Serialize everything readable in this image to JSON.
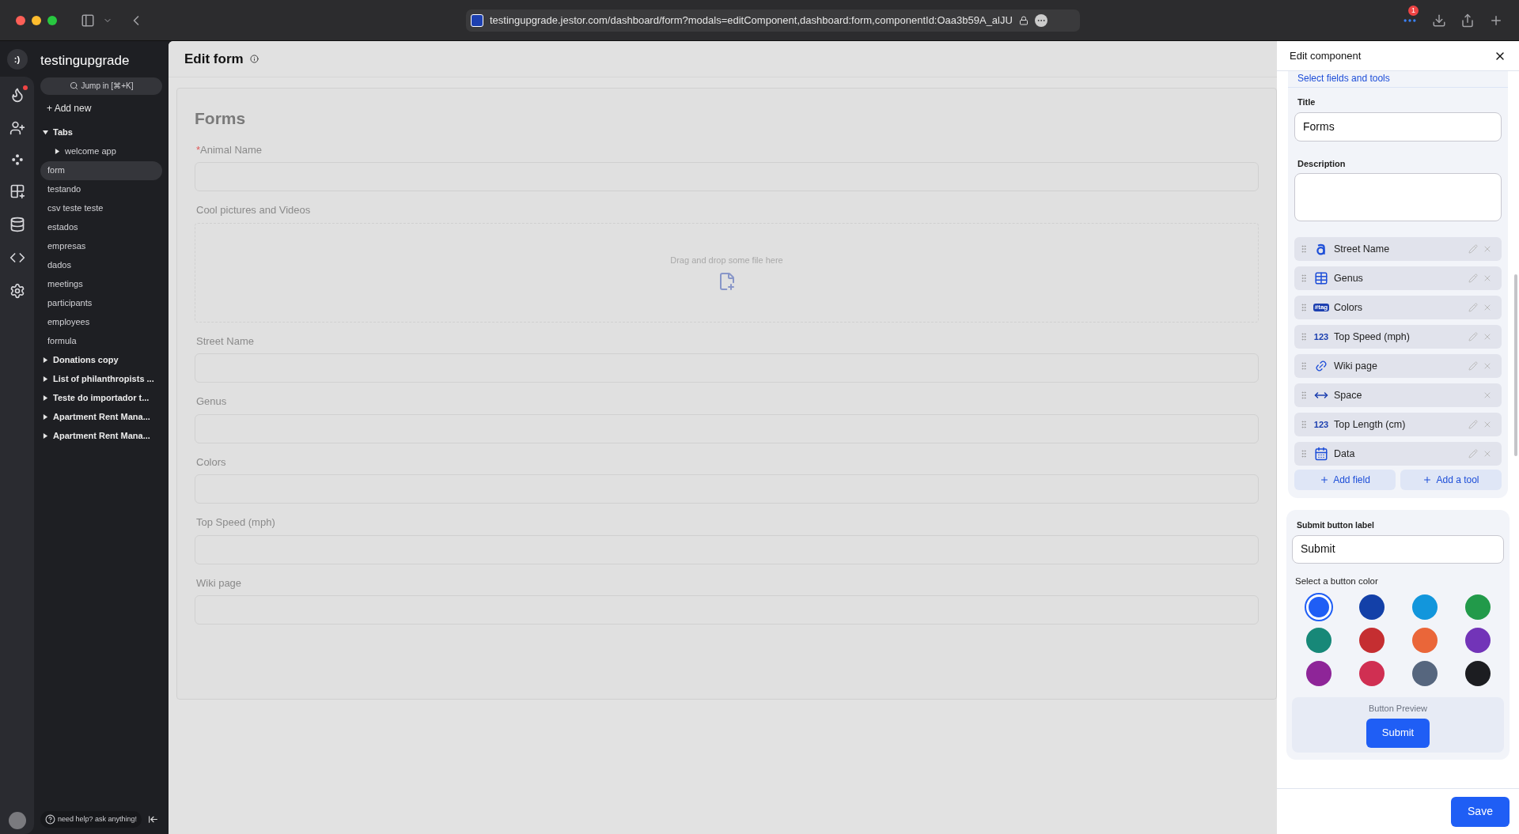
{
  "browser": {
    "url": "testingupgrade.jestor.com/dashboard/form?modals=editComponent,dashboard:form,componentId:Oaa3b59A_alJU",
    "notifications": "1"
  },
  "rail": [
    {
      "kind": "flame",
      "dot": true
    },
    {
      "kind": "user-plus",
      "dot": false
    },
    {
      "kind": "nodes",
      "dot": false
    },
    {
      "kind": "grid-plus",
      "dot": false
    },
    {
      "kind": "database",
      "dot": false
    },
    {
      "kind": "code",
      "dot": false
    },
    {
      "kind": "gear",
      "dot": false
    }
  ],
  "sidebar": {
    "logo": ":)",
    "workspace": "testingupgrade",
    "search": "Jump in [⌘+K]",
    "add_new": "+ Add new",
    "help": "need help? ask anything!",
    "items": [
      {
        "label": "Tabs",
        "kind": "folder",
        "expanded": true,
        "selected": false,
        "children": [
          {
            "label": "welcome app",
            "kind": "folder",
            "expanded": false,
            "selected": false
          },
          {
            "label": "form",
            "kind": "page",
            "selected": true
          },
          {
            "label": "testando",
            "kind": "page",
            "selected": false
          },
          {
            "label": "csv teste teste",
            "kind": "page",
            "selected": false
          },
          {
            "label": "estados",
            "kind": "page",
            "selected": false
          },
          {
            "label": "empresas",
            "kind": "page",
            "selected": false
          },
          {
            "label": "dados",
            "kind": "page",
            "selected": false
          },
          {
            "label": "meetings",
            "kind": "page",
            "selected": false
          },
          {
            "label": "participants",
            "kind": "page",
            "selected": false
          },
          {
            "label": "employees",
            "kind": "page",
            "selected": false
          },
          {
            "label": "formula",
            "kind": "page",
            "selected": false
          }
        ]
      },
      {
        "label": "Donations copy",
        "kind": "folder",
        "expanded": false,
        "selected": false
      },
      {
        "label": "List of philanthropists ...",
        "kind": "folder",
        "expanded": false,
        "selected": false
      },
      {
        "label": "Teste do importador t...",
        "kind": "folder",
        "expanded": false,
        "selected": false
      },
      {
        "label": "Apartment Rent Mana...",
        "kind": "folder",
        "expanded": false,
        "selected": false
      },
      {
        "label": "Apartment Rent Mana...",
        "kind": "folder",
        "expanded": false,
        "selected": false
      }
    ]
  },
  "page": {
    "title": "Edit form",
    "form_title": "Forms",
    "required_mark": "*",
    "fields": [
      {
        "label": "Animal Name",
        "kind": "input",
        "required": true
      },
      {
        "label": "Cool pictures and Videos",
        "kind": "file",
        "required": false,
        "placeholder": "Drag and drop some file here"
      },
      {
        "label": "Street Name",
        "kind": "input",
        "required": false
      },
      {
        "label": "Genus",
        "kind": "input",
        "required": false
      },
      {
        "label": "Colors",
        "kind": "input",
        "required": false
      },
      {
        "label": "Top Speed (mph)",
        "kind": "input",
        "required": false
      },
      {
        "label": "Wiki page",
        "kind": "input",
        "required": false
      }
    ]
  },
  "panel": {
    "title": "Edit component",
    "section_link": "Select fields and tools",
    "title_label": "Title",
    "title_value": "Forms",
    "description_label": "Description",
    "components": [
      {
        "label": "Street Name",
        "kind": "text",
        "editable": true
      },
      {
        "label": "Genus",
        "kind": "table",
        "editable": true
      },
      {
        "label": "Colors",
        "kind": "tag",
        "editable": true,
        "tag": "#tag"
      },
      {
        "label": "Top Speed (mph)",
        "kind": "number",
        "editable": true,
        "badge": "123"
      },
      {
        "label": "Wiki page",
        "kind": "link",
        "editable": true
      },
      {
        "label": "Space",
        "kind": "space",
        "editable": false
      },
      {
        "label": "Top Length (cm)",
        "kind": "number",
        "editable": true,
        "badge": "123"
      },
      {
        "label": "Data",
        "kind": "date",
        "editable": true
      }
    ],
    "add_field": "Add field",
    "add_tool": "Add a tool",
    "submit_label": "Submit button label",
    "submit_value": "Submit",
    "color_label": "Select a button color",
    "colors": [
      {
        "color": "#1f5ef5",
        "selected": true
      },
      {
        "color": "#1340a8",
        "selected": false
      },
      {
        "color": "#1296dc",
        "selected": false
      },
      {
        "color": "#229a4a",
        "selected": false
      },
      {
        "color": "#178878",
        "selected": false
      },
      {
        "color": "#c52e31",
        "selected": false
      },
      {
        "color": "#ea6639",
        "selected": false
      },
      {
        "color": "#7234b8",
        "selected": false
      },
      {
        "color": "#8e2598",
        "selected": false
      },
      {
        "color": "#d02f52",
        "selected": false
      },
      {
        "color": "#56667e",
        "selected": false
      },
      {
        "color": "#1c1d21",
        "selected": false
      }
    ],
    "preview_label": "Button Preview",
    "preview_button": "Submit",
    "save": "Save"
  }
}
